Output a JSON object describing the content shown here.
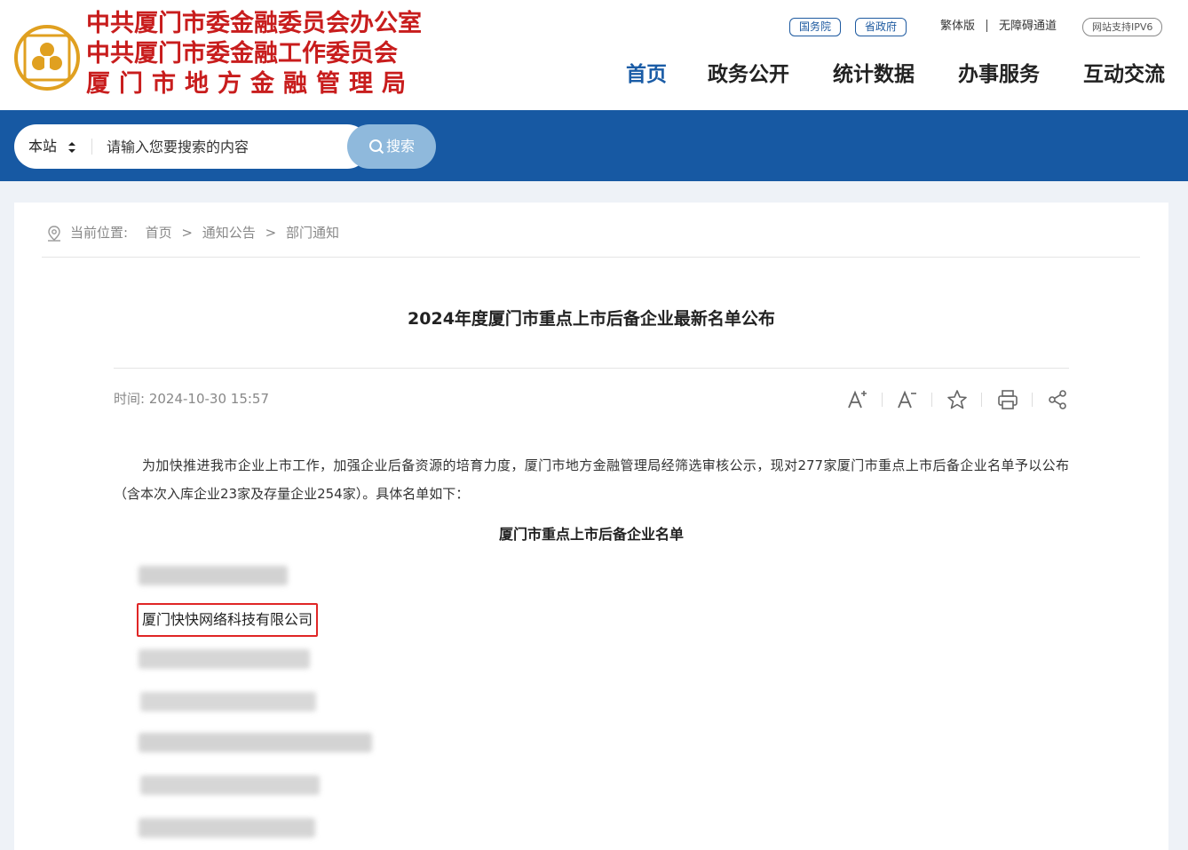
{
  "header": {
    "org_names": [
      "中共厦门市委金融委员会办公室",
      "中共厦门市委金融工作委员会",
      "厦门市地方金融管理局"
    ],
    "logo": "government-finance-emblem",
    "top_links": {
      "guowuyuan": "国务院",
      "shengzhengfu": "省政府",
      "traditional": "繁体版",
      "accessible": "无障碍通道",
      "ipv6": "网站支持IPV6"
    },
    "nav": [
      "首页",
      "政务公开",
      "统计数据",
      "办事服务",
      "互动交流"
    ],
    "active_nav": "首页"
  },
  "search": {
    "scope": "本站",
    "placeholder": "请输入您要搜索的内容",
    "button": "搜索"
  },
  "breadcrumb": {
    "label": "当前位置:",
    "items": [
      "首页",
      "通知公告",
      "部门通知"
    ],
    "separator": ">"
  },
  "article": {
    "title": "2024年度厦门市重点上市后备企业最新名单公布",
    "time_label": "时间:",
    "time": "2024-10-30 15:57",
    "tools": [
      "font-increase-icon",
      "font-decrease-icon",
      "favorite-star-icon",
      "print-icon",
      "share-icon"
    ],
    "paragraph": "为加快推进我市企业上市工作，加强企业后备资源的培育力度，厦门市地方金融管理局经筛选审核公示，现对277家厦门市重点上市后备企业名单予以公布（含本次入库企业23家及存量企业254家）。具体名单如下：",
    "list_title": "厦门市重点上市后备企业名单",
    "highlighted_company": "厦门快快网络科技有限公司"
  },
  "colors": {
    "brand_blue": "#1759a3",
    "org_red": "#c81d1d",
    "highlight_border": "#e02626",
    "search_button": "#8fb9dc"
  }
}
